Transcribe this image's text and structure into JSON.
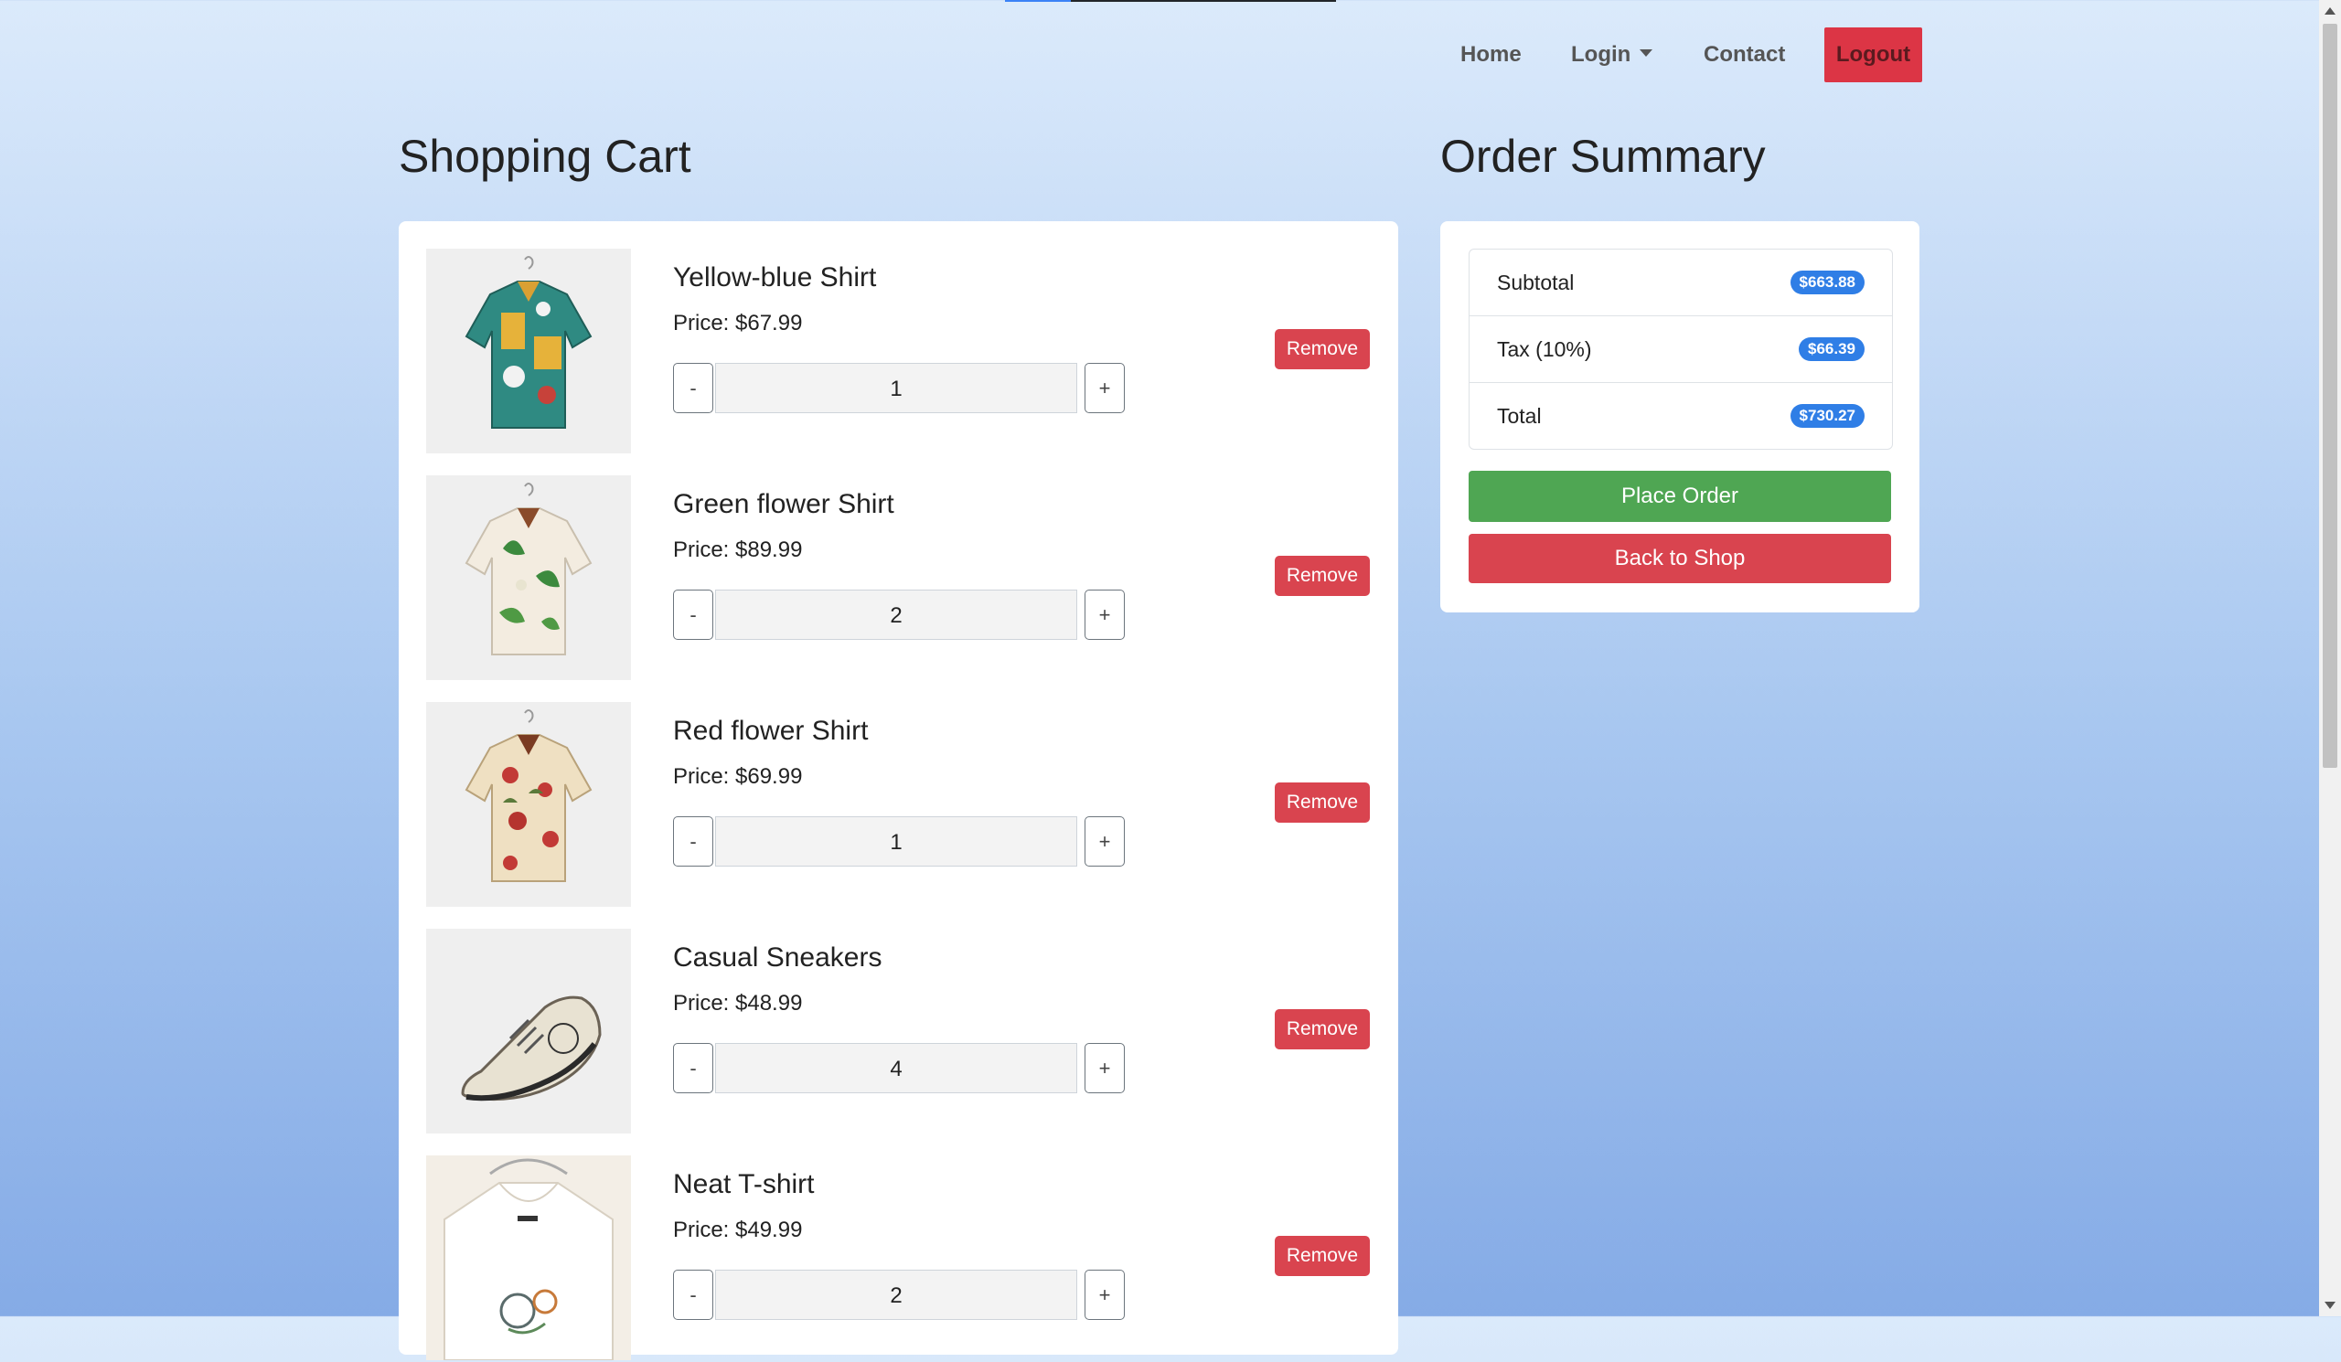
{
  "nav": {
    "home": "Home",
    "login": "Login",
    "contact": "Contact",
    "logout": "Logout"
  },
  "cart": {
    "title": "Shopping Cart",
    "items": [
      {
        "name": "Yellow-blue Shirt",
        "price": "Price: $67.99",
        "qty": "1",
        "remove": "Remove"
      },
      {
        "name": "Green flower Shirt",
        "price": "Price: $89.99",
        "qty": "2",
        "remove": "Remove"
      },
      {
        "name": "Red flower Shirt",
        "price": "Price: $69.99",
        "qty": "1",
        "remove": "Remove"
      },
      {
        "name": "Casual Sneakers",
        "price": "Price: $48.99",
        "qty": "4",
        "remove": "Remove"
      },
      {
        "name": "Neat T-shirt",
        "price": "Price: $49.99",
        "qty": "2",
        "remove": "Remove"
      }
    ],
    "minus": "-",
    "plus": "+"
  },
  "summary": {
    "title": "Order Summary",
    "subtotal_label": "Subtotal",
    "subtotal_value": "$663.88",
    "tax_label": "Tax (10%)",
    "tax_value": "$66.39",
    "total_label": "Total",
    "total_value": "$730.27",
    "place_order": "Place Order",
    "back_to_shop": "Back to Shop"
  },
  "colors": {
    "accent_red": "#d9444f",
    "accent_green": "#4fa653",
    "badge_blue": "#2f7ee6"
  }
}
